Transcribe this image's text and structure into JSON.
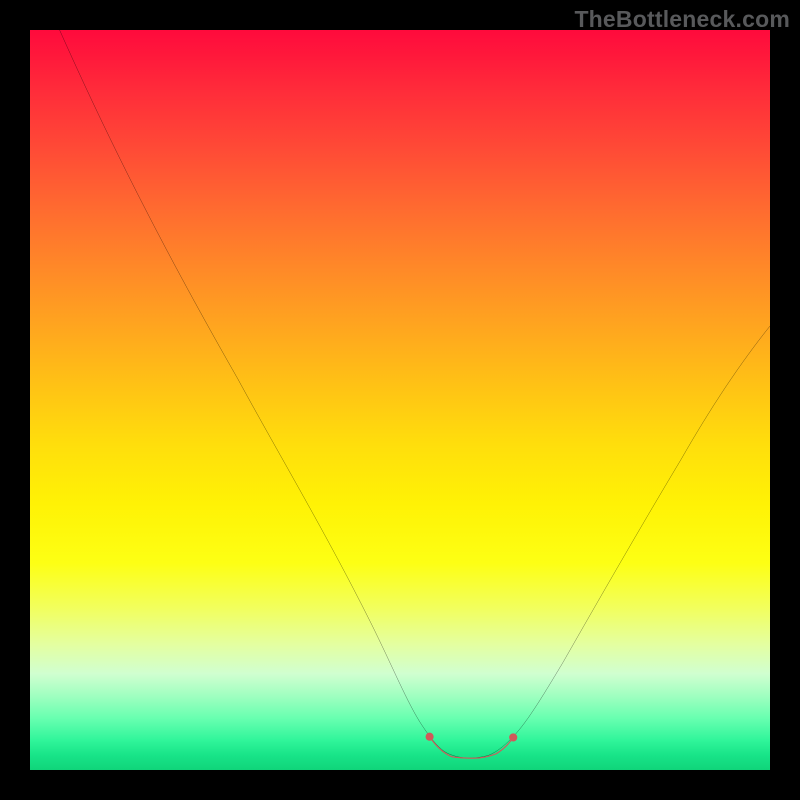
{
  "watermark": "TheBottleneck.com",
  "chart_data": {
    "type": "line",
    "title": "",
    "xlabel": "",
    "ylabel": "",
    "xlim": [
      0,
      100
    ],
    "ylim": [
      0,
      100
    ],
    "grid": false,
    "legend": false,
    "series": [
      {
        "name": "bottleneck-curve",
        "color": "#000000",
        "x": [
          4,
          10,
          16,
          22,
          28,
          34,
          40,
          46,
          50,
          54,
          56,
          58,
          60,
          64,
          68,
          72,
          76,
          82,
          88,
          94,
          100
        ],
        "y": [
          100,
          89,
          78,
          67,
          56,
          45,
          34,
          22,
          12,
          6,
          3,
          2,
          2,
          3,
          7,
          14,
          22,
          32,
          42,
          52,
          60
        ]
      },
      {
        "name": "optimal-range-marker",
        "color": "#d05a5a",
        "x": [
          54,
          55,
          56,
          57,
          58,
          59,
          60,
          61,
          62,
          63,
          64,
          65
        ],
        "y": [
          4.5,
          3.0,
          2.2,
          1.8,
          1.6,
          1.6,
          1.6,
          1.8,
          2.2,
          2.8,
          3.6,
          4.8
        ]
      }
    ],
    "annotations": []
  }
}
